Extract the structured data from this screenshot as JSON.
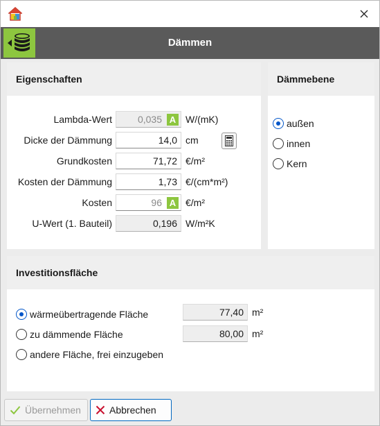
{
  "header": {
    "title": "Dämmen"
  },
  "eigenschaften": {
    "title": "Eigenschaften",
    "rows": {
      "lambda": {
        "label": "Lambda-Wert",
        "value": "0,035",
        "unit": "W/(mK)",
        "badge": "A"
      },
      "dicke": {
        "label": "Dicke der Dämmung",
        "value": "14,0",
        "unit": "cm"
      },
      "grundkosten": {
        "label": "Grundkosten",
        "value": "71,72",
        "unit": "€/m²"
      },
      "kosten_daemmung": {
        "label": "Kosten der Dämmung",
        "value": "1,73",
        "unit": "€/(cm*m²)"
      },
      "kosten": {
        "label": "Kosten",
        "value": "96",
        "unit": "€/m²",
        "badge": "A"
      },
      "uwert": {
        "label": "U-Wert (1. Bauteil)",
        "value": "0,196",
        "unit": "W/m²K"
      }
    }
  },
  "daemmebene": {
    "title": "Dämmebene",
    "options": [
      {
        "label": "außen",
        "selected": true
      },
      {
        "label": "innen",
        "selected": false
      },
      {
        "label": "Kern",
        "selected": false
      }
    ]
  },
  "investition": {
    "title": "Investitionsfläche",
    "options": [
      {
        "label": "wärmeübertragende Fläche",
        "selected": true,
        "value": "77,40",
        "unit": "m²"
      },
      {
        "label": "zu dämmende Fläche",
        "selected": false,
        "value": "80,00",
        "unit": "m²"
      },
      {
        "label": "andere Fläche, frei einzugeben",
        "selected": false
      }
    ]
  },
  "footer": {
    "apply_label": "Übernehmen",
    "cancel_label": "Abbrechen"
  },
  "colors": {
    "accent_green": "#8dc63f",
    "header_bg": "#5a5a5a",
    "selection_blue": "#0055c8"
  }
}
